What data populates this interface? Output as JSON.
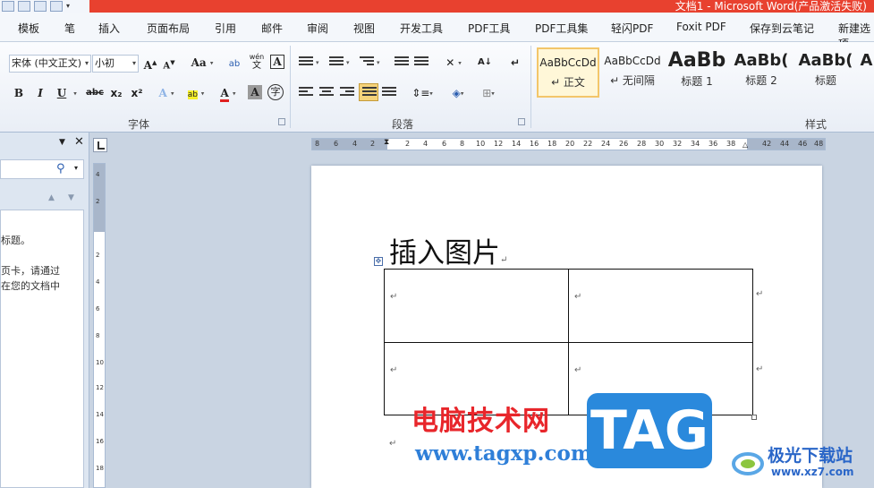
{
  "window": {
    "title": "文档1 - Microsoft Word(产品激活失败)"
  },
  "tabs": [
    "模板",
    "笔",
    "插入",
    "页面布局",
    "引用",
    "邮件",
    "审阅",
    "视图",
    "开发工具",
    "PDF工具",
    "PDF工具集",
    "轻闪PDF",
    "Foxit PDF",
    "保存到云笔记",
    "新建选项"
  ],
  "ribbon": {
    "font": {
      "group_label": "字体",
      "font_name": "宋体 (中文正文)",
      "font_size": "小初",
      "grow_font": "A",
      "shrink_font": "A",
      "change_case": "Aa",
      "bold": "B",
      "italic": "I",
      "underline": "U",
      "strikethrough": "abc",
      "subscript": "x₂",
      "superscript": "x²",
      "font_color": "A",
      "char_shading": "A",
      "enclose_char": "字",
      "phonetic": "wén",
      "clear_format_label": "文"
    },
    "paragraph": {
      "group_label": "段落"
    },
    "styles": {
      "group_label": "样式",
      "items": [
        {
          "sample": "AaBbCcDd",
          "name": "↵ 正文"
        },
        {
          "sample": "AaBbCcDd",
          "name": "↵ 无间隔"
        },
        {
          "sample": "AaBb",
          "name": "标题 1"
        },
        {
          "sample": "AaBb(",
          "name": "标题 2"
        },
        {
          "sample": "AaBb(",
          "name": "标题"
        },
        {
          "sample": "A",
          "name": ""
        }
      ]
    }
  },
  "nav_pane": {
    "text_lines": [
      "标题。",
      "页卡，请通过",
      "在您的文档中"
    ]
  },
  "rulers": {
    "horizontal_left_ticks": [
      "8",
      "6",
      "4",
      "2"
    ],
    "horizontal_ticks": [
      "2",
      "4",
      "6",
      "8",
      "10",
      "12",
      "14",
      "16",
      "18",
      "20",
      "22",
      "24",
      "26",
      "28",
      "30",
      "32",
      "34",
      "36",
      "38",
      "42",
      "44",
      "46",
      "48"
    ],
    "vertical_ticks": [
      "4",
      "2",
      "2",
      "4",
      "6",
      "8",
      "10",
      "12",
      "14",
      "16",
      "18"
    ]
  },
  "document": {
    "heading": "插入图片",
    "paragraph_mark": "↵",
    "table": {
      "rows": 2,
      "cols": 2
    }
  },
  "watermarks": {
    "cn_site": "电脑技术网",
    "url": "www.tagxp.com",
    "tag": "TAG",
    "brand2_cn": "极光下载站",
    "brand2_url": "www.xz7.com"
  }
}
